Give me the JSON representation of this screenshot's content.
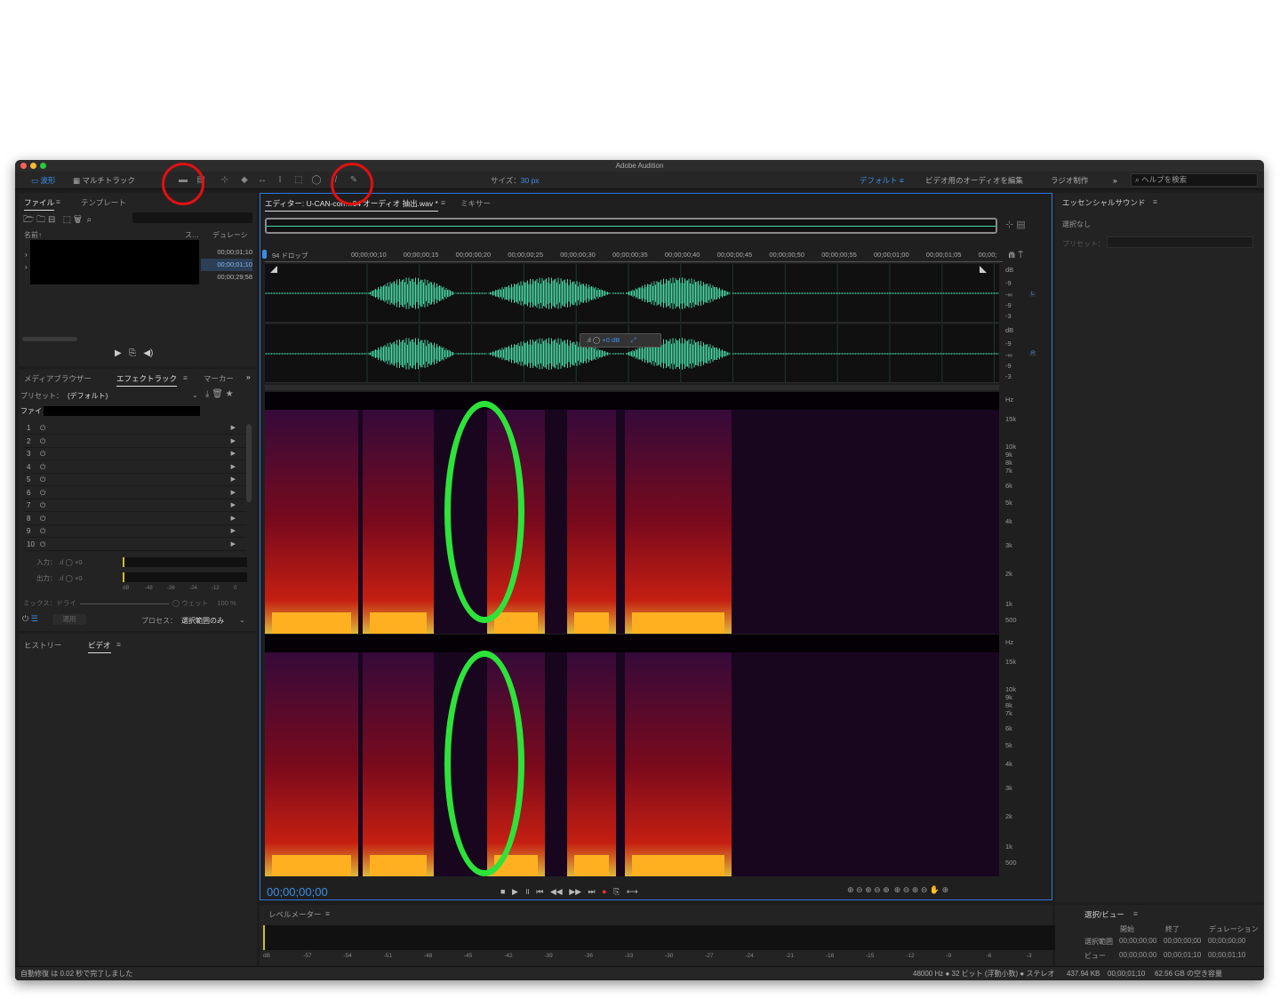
{
  "app": {
    "title": "Adobe Audition"
  },
  "toolbar": {
    "waveform": "波形",
    "multitrack": "マルチトラック",
    "size_label": "サイズ：",
    "size_value": "30 px",
    "workspace_default": "デフォルト",
    "workspace_video": "ビデオ用のオーディオを編集",
    "workspace_radio": "ラジオ制作",
    "help_search": "ヘルプを検索"
  },
  "files": {
    "tab_files": "ファイル",
    "tab_templates": "テンプレート",
    "col_name": "名前↑",
    "col_status": "ス…",
    "col_duration": "デュレーシ",
    "durations": [
      "00;00;01;10",
      "00;00;01;10",
      "00;00;29;58"
    ]
  },
  "effects": {
    "tab_media": "メディアブラウザー",
    "tab_rack": "エフェクトラック",
    "tab_markers": "マーカー",
    "preset_label": "プリセット：",
    "preset_value": "(デフォルト)",
    "file_label": "ファイ",
    "slots": [
      "1",
      "2",
      "3",
      "4",
      "5",
      "6",
      "7",
      "8",
      "9",
      "10"
    ],
    "input_label": "入力：",
    "input_value": "+0",
    "output_label": "出力：",
    "output_value": "+0",
    "meter_ticks": [
      "dB",
      "-48",
      "-36",
      "-24",
      "-12",
      "0"
    ],
    "mix_label": "ミックス：",
    "mix_dry": "ドライ",
    "mix_wet": "ウェット",
    "mix_value": "100 %",
    "apply": "適用",
    "process_label": "プロセス：",
    "process_value": "選択範囲のみ"
  },
  "lower_left": {
    "tab_history": "ヒストリー",
    "tab_video": "ビデオ"
  },
  "editor": {
    "tab_editor": "エディター: U-CAN-con…04 オーディオ 抽出.wav *",
    "tab_mixer": "ミキサー",
    "ruler_start": "94 ドロップ",
    "ruler_ticks": [
      "00;00;00;10",
      "00;00;00;15",
      "00;00;00;20",
      "00;00;00;25",
      "00;00;00;30",
      "00;00;00;35",
      "00;00;00;40",
      "00;00;00;45",
      "00;00;00;50",
      "00;00;00;55",
      "00;00;01;00",
      "00;00;01;05",
      "00;00;"
    ],
    "db_labels": [
      "dB",
      "-9",
      "-∞",
      "-9",
      "-3"
    ],
    "hud_gain": "+0 dB",
    "ch_left": "L",
    "ch_right": "R",
    "hz_labels": [
      "Hz",
      "15k",
      "10k",
      "9k",
      "8k",
      "7k",
      "6k",
      "5k",
      "4k",
      "3k",
      "2k",
      "1k",
      "500"
    ],
    "timecode": "00;00;00;00"
  },
  "essential": {
    "title": "エッセンシャルサウンド",
    "no_selection": "選択なし",
    "preset_label": "プリセット："
  },
  "level_meter": {
    "title": "レベルメーター",
    "ticks": [
      "dB",
      "-57",
      "-54",
      "-51",
      "-48",
      "-45",
      "-42",
      "-39",
      "-36",
      "-33",
      "-30",
      "-27",
      "-24",
      "-21",
      "-18",
      "-15",
      "-12",
      "-9",
      "-6",
      "-3",
      "0"
    ]
  },
  "selection_view": {
    "title": "選択/ビュー",
    "col_start": "開始",
    "col_end": "終了",
    "col_duration": "デュレーション",
    "sel_label": "選択範囲",
    "sel_start": "00;00;00;00",
    "sel_end": "00;00;00;00",
    "sel_dur": "00;00;00;00",
    "view_label": "ビュー",
    "view_start": "00;00;00;00",
    "view_end": "00;00;01;10",
    "view_dur": "00;00;01;10"
  },
  "status": {
    "message": "自動修復 は 0.02 秒で完了しました",
    "format": "48000 Hz ● 32 ビット (浮動小数) ● ステレオ",
    "size": "437.94 KB",
    "duration": "00;00;01;10",
    "free": "62.56 GB の空き容量"
  },
  "colors": {
    "accent": "#3d8ee8",
    "wave": "#49d6a5",
    "annotation_green": "#2de33a",
    "annotation_red": "#e31010"
  }
}
